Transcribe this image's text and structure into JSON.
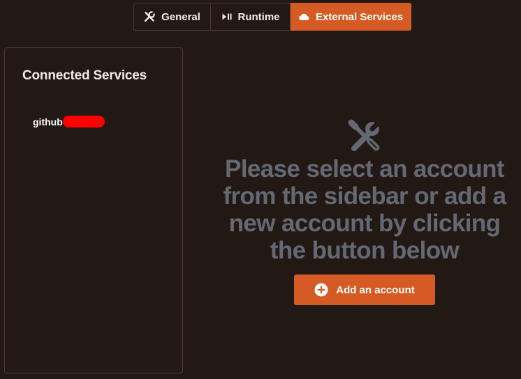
{
  "tabs": [
    {
      "label": "General",
      "icon": "tools-icon",
      "active": false
    },
    {
      "label": "Runtime",
      "icon": "play-pause-icon",
      "active": false
    },
    {
      "label": "External Services",
      "icon": "cloud-icon",
      "active": true
    }
  ],
  "sidebar": {
    "title": "Connected Services",
    "accounts": [
      {
        "label": "github"
      }
    ]
  },
  "main": {
    "icon": "tools-icon",
    "message": "Please select an account from the sidebar or add a new account by clicking the button below",
    "add_button_label": "Add an account",
    "add_button_icon": "plus-circle-icon"
  },
  "colors": {
    "background": "#221915",
    "accent": "#d55a23",
    "muted_text": "#656873",
    "border": "#4a3d33",
    "redaction": "#ff0000"
  }
}
